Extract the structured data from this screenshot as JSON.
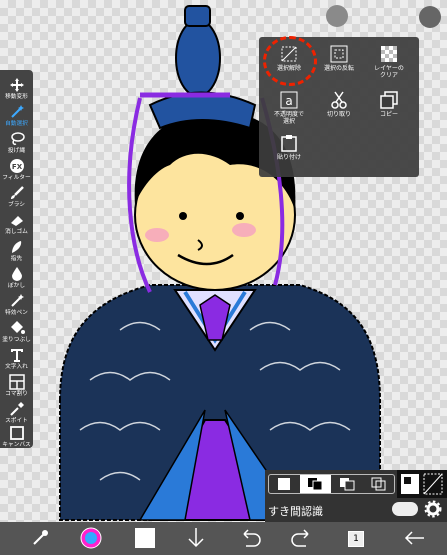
{
  "toolbar": {
    "items": [
      {
        "label": "移動変形",
        "icon": "move-icon"
      },
      {
        "label": "自動選択",
        "icon": "magic-wand-icon",
        "active": true
      },
      {
        "label": "投げ縄",
        "icon": "lasso-icon"
      },
      {
        "label": "フィルター",
        "icon": "fx-icon"
      },
      {
        "label": "ブラシ",
        "icon": "brush-icon"
      },
      {
        "label": "消しゴム",
        "icon": "eraser-icon"
      },
      {
        "label": "指先",
        "icon": "finger-icon"
      },
      {
        "label": "ぼかし",
        "icon": "blur-drop-icon"
      },
      {
        "label": "特効ペン",
        "icon": "special-pen-icon"
      },
      {
        "label": "塗りつぶし",
        "icon": "bucket-icon"
      },
      {
        "label": "文字入れ",
        "icon": "text-icon"
      },
      {
        "label": "コマ割り",
        "icon": "frame-divider-icon"
      },
      {
        "label": "スポイト",
        "icon": "eyedropper-icon"
      },
      {
        "label": "キャンバス",
        "icon": "canvas-icon"
      }
    ]
  },
  "menu": {
    "items": [
      {
        "label": "選択解除",
        "icon": "deselect-icon"
      },
      {
        "label": "選択の反転",
        "icon": "invert-selection-icon"
      },
      {
        "label": "レイヤーの\nクリア",
        "icon": "clear-layer-icon"
      },
      {
        "label": "不透明度で\n選択",
        "icon": "opacity-select-icon"
      },
      {
        "label": "切り取り",
        "icon": "scissors-icon"
      },
      {
        "label": "コピー",
        "icon": "copy-icon"
      },
      {
        "label": "貼り付け",
        "icon": "paste-icon"
      }
    ]
  },
  "panel": {
    "label": "すき間認識",
    "toggle_on": true
  },
  "bottombar": {
    "layer_count": "1"
  },
  "colors": {
    "accent": "#3da9ff",
    "selection_circle": "#ee2200",
    "kimono": "#1b3358",
    "hat": "#2253a0",
    "purple": "#8a2be2"
  }
}
